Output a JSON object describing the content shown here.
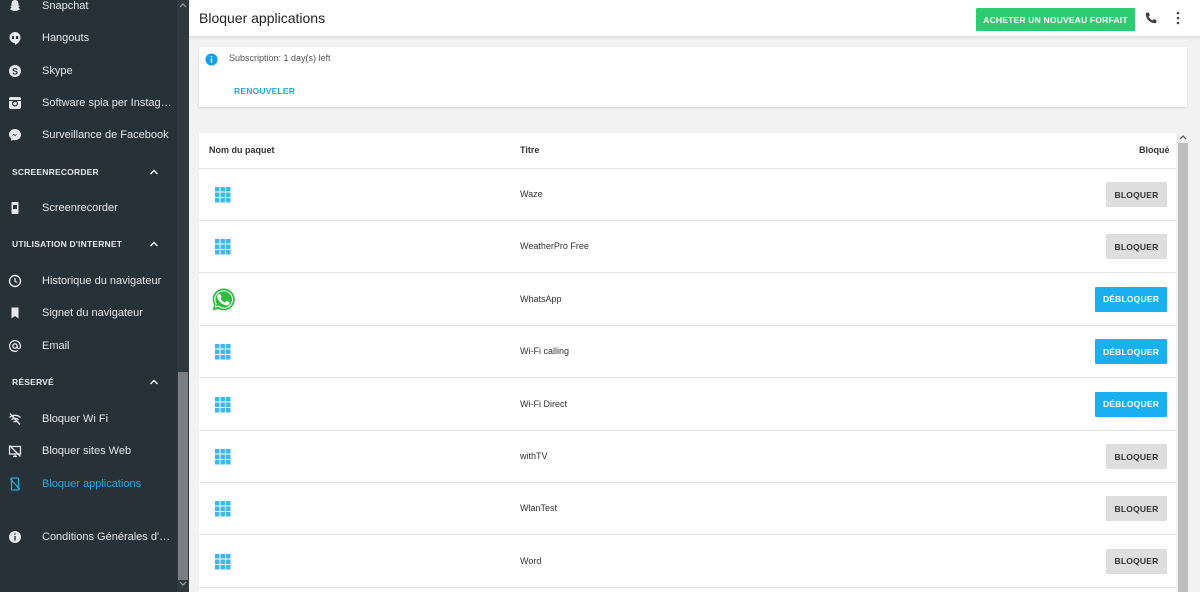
{
  "sidebar": {
    "items_top": [
      {
        "label": "Snapchat",
        "icon": "snapchat-icon"
      },
      {
        "label": "Hangouts",
        "icon": "hangouts-icon"
      },
      {
        "label": "Skype",
        "icon": "skype-icon"
      },
      {
        "label": "Software spia per Instagram",
        "icon": "instagram-icon"
      },
      {
        "label": "Surveillance de Facebook",
        "icon": "messenger-icon"
      }
    ],
    "section_screenrecorder": "SCREENRECORDER",
    "item_screenrecorder": "Screenrecorder",
    "section_internet": "UTILISATION D'INTERNET",
    "item_history": "Historique du navigateur",
    "item_bookmark": "Signet du navigateur",
    "item_email": "Email",
    "section_reserved": "RÉSERVÉ",
    "item_block_wifi": "Bloquer Wi Fi",
    "item_block_sites": "Bloquer sites Web",
    "item_block_apps": "Bloquer applications",
    "item_terms": "Conditions Générales d'utilisation"
  },
  "header": {
    "title": "Bloquer applications",
    "buy_button": "ACHETER UN NOUVEAU FORFAIT"
  },
  "subscription": {
    "text": "Subscription: 1 day(s) left",
    "renew": "RENOUVELER"
  },
  "table": {
    "col_package": "Nom du paquet",
    "col_title": "Titre",
    "col_blocked": "Bloqué",
    "rows": [
      {
        "title": "Waze",
        "action": "BLOQUER",
        "icon": "grid-icon"
      },
      {
        "title": "WeatherPro Free",
        "action": "BLOQUER",
        "icon": "grid-icon"
      },
      {
        "title": "WhatsApp",
        "action": "DÉBLOQUER",
        "icon": "whatsapp-icon"
      },
      {
        "title": "Wi-Fi calling",
        "action": "DÉBLOQUER",
        "icon": "grid-icon"
      },
      {
        "title": "Wi-Fi Direct",
        "action": "DÉBLOQUER",
        "icon": "grid-icon"
      },
      {
        "title": "withTV",
        "action": "BLOQUER",
        "icon": "grid-icon"
      },
      {
        "title": "WlanTest",
        "action": "BLOQUER",
        "icon": "grid-icon"
      },
      {
        "title": "Word",
        "action": "BLOQUER",
        "icon": "grid-icon"
      }
    ]
  },
  "colors": {
    "sidebar_bg": "#263238",
    "accent": "#1ab0f0",
    "buy_green": "#2ecc71"
  }
}
